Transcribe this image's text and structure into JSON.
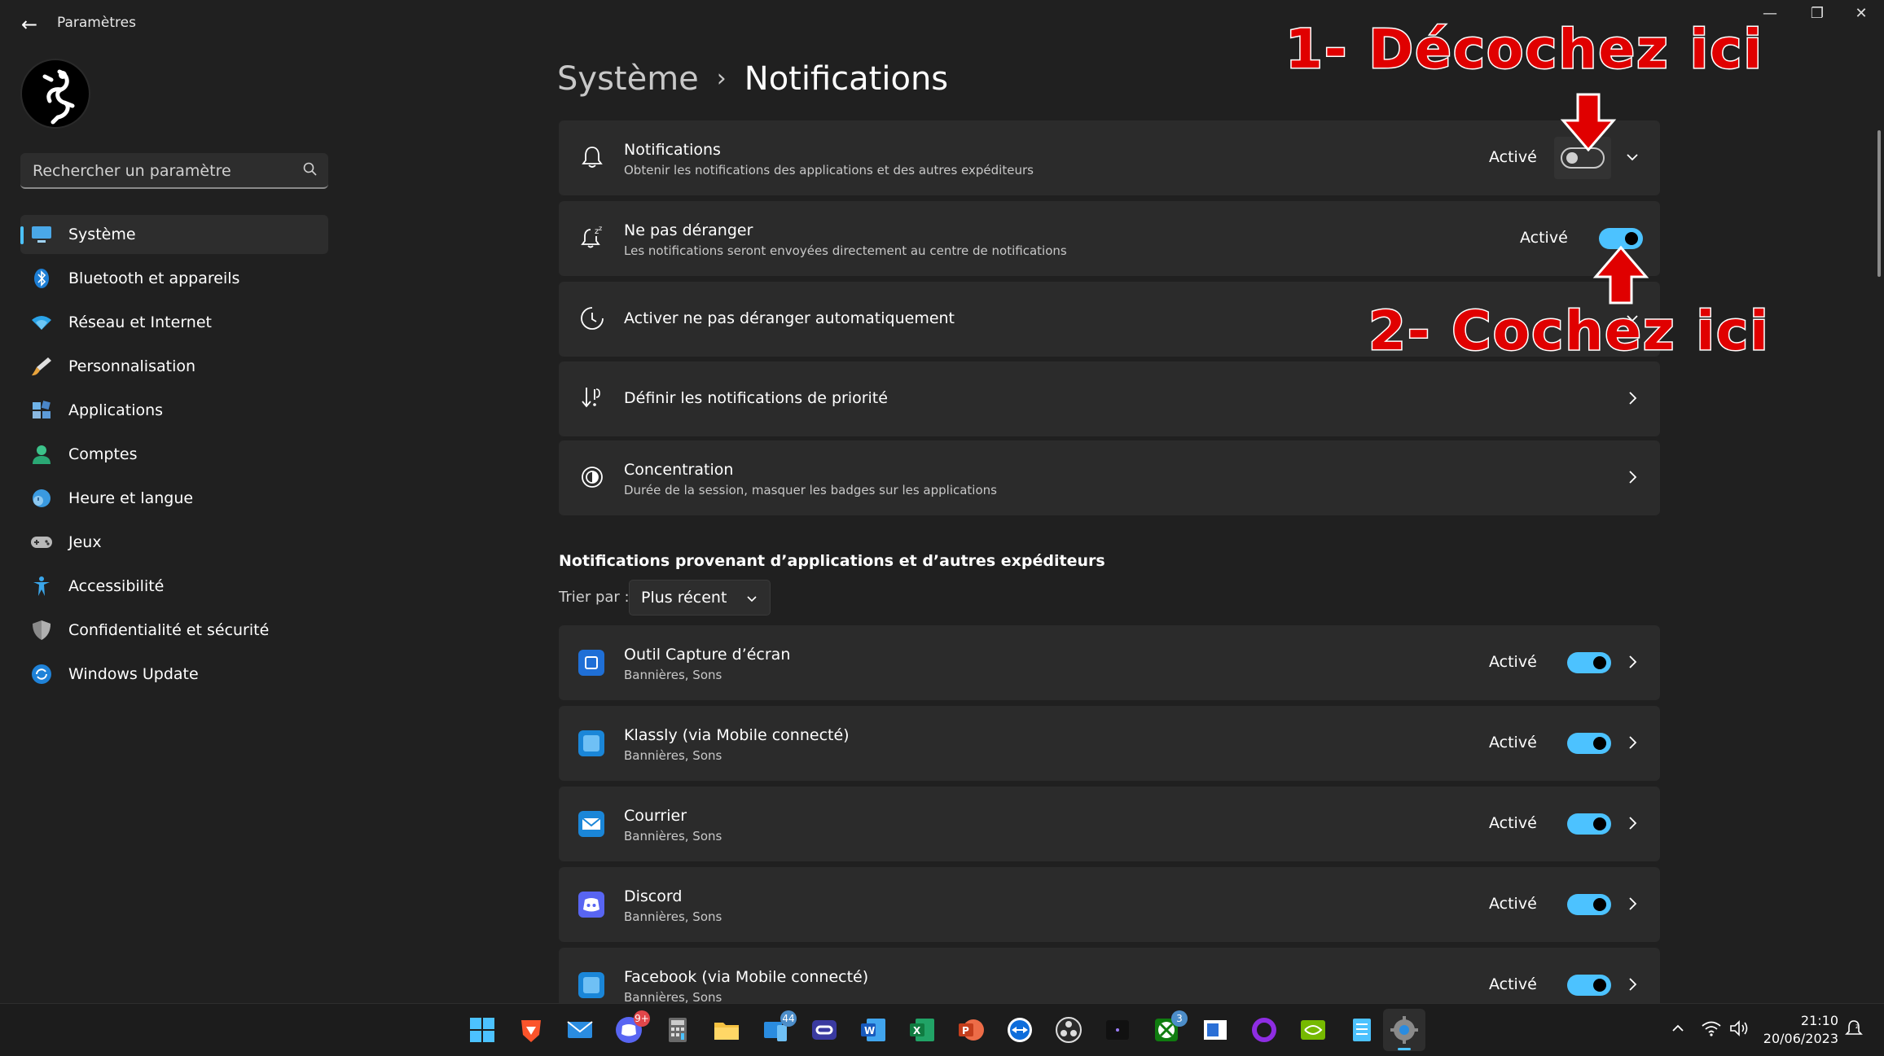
{
  "window": {
    "title": "Paramètres",
    "back_glyph": "←",
    "controls": [
      "—",
      "❐",
      "✕"
    ]
  },
  "sidebar": {
    "search_placeholder": "Rechercher un paramètre",
    "items": [
      {
        "label": "Système",
        "icon": "monitor-icon",
        "active": true
      },
      {
        "label": "Bluetooth et appareils",
        "icon": "bluetooth-icon"
      },
      {
        "label": "Réseau et Internet",
        "icon": "wifi-icon"
      },
      {
        "label": "Personnalisation",
        "icon": "brush-icon"
      },
      {
        "label": "Applications",
        "icon": "apps-icon"
      },
      {
        "label": "Comptes",
        "icon": "person-icon"
      },
      {
        "label": "Heure et langue",
        "icon": "clock-globe-icon"
      },
      {
        "label": "Jeux",
        "icon": "gamepad-icon"
      },
      {
        "label": "Accessibilité",
        "icon": "accessibility-icon"
      },
      {
        "label": "Confidentialité et sécurité",
        "icon": "shield-icon"
      },
      {
        "label": "Windows Update",
        "icon": "update-icon"
      }
    ]
  },
  "breadcrumb": {
    "parent": "Système",
    "separator": "›",
    "current": "Notifications"
  },
  "settings": [
    {
      "title": "Notifications",
      "subtitle": "Obtenir les notifications des applications et des autres expéditeurs",
      "state": "Activé",
      "toggle": "off",
      "chevron": "down"
    },
    {
      "title": "Ne pas déranger",
      "subtitle": "Les notifications seront envoyées directement au centre de notifications",
      "state": "Activé",
      "toggle": "on"
    },
    {
      "title": "Activer ne pas déranger automatiquement",
      "chevron": "down"
    },
    {
      "title": "Définir les notifications de priorité",
      "chevron": "right"
    },
    {
      "title": "Concentration",
      "subtitle": "Durée de la session, masquer les badges sur les applications",
      "chevron": "right"
    }
  ],
  "apps_section": {
    "title": "Notifications provenant d’applications et d’autres expéditeurs",
    "sort_label": "Trier par :",
    "sort_value": "Plus récent",
    "apps": [
      {
        "name": "Outil Capture d’écran",
        "detail": "Bannières, Sons",
        "state": "Activé",
        "toggle": "on",
        "icon_color": "#1f6fd6"
      },
      {
        "name": "Klassly (via Mobile connecté)",
        "detail": "Bannières, Sons",
        "state": "Activé",
        "toggle": "on",
        "icon_color": "#1a86d8"
      },
      {
        "name": "Courrier",
        "detail": "Bannières, Sons",
        "state": "Activé",
        "toggle": "on",
        "icon_color": "#1a86d8"
      },
      {
        "name": "Discord",
        "detail": "Bannières, Sons",
        "state": "Activé",
        "toggle": "on",
        "icon_color": "#5865f2"
      },
      {
        "name": "Facebook (via Mobile connecté)",
        "detail": "Bannières, Sons",
        "state": "Activé",
        "toggle": "on",
        "icon_color": "#1a86d8"
      }
    ]
  },
  "annotations": {
    "step1": "1-  Décochez ici",
    "step2": "2-  Cochez ici"
  },
  "colors": {
    "accent": "#4cc2ff",
    "annotation_red": "#e00000",
    "background": "#202020",
    "card": "#2b2b2b"
  },
  "taskbar": {
    "icons": [
      "start-icon",
      "brave-icon",
      "mail-icon",
      "discord-icon",
      "calculator-icon",
      "explorer-icon",
      "phone-link-icon",
      "oculus-icon",
      "word-icon",
      "excel-icon",
      "powerpoint-icon",
      "teamviewer-icon",
      "obs-icon",
      "terminal-icon",
      "xbox-icon",
      "app-icon",
      "cortana-icon",
      "nvidia-icon",
      "notepad-icon",
      "settings-icon"
    ],
    "badges": {
      "discord": "9+",
      "phone_link": "44",
      "xbox": "3"
    },
    "time": "21:10",
    "date": "20/06/2023"
  }
}
